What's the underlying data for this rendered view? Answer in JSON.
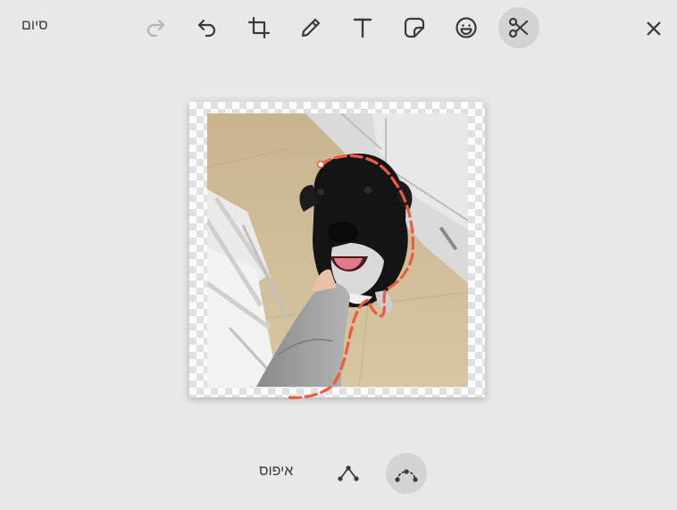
{
  "toolbar": {
    "done_label": "סיום",
    "tools": [
      {
        "name": "redo",
        "icon": "redo-icon",
        "disabled": true
      },
      {
        "name": "undo",
        "icon": "undo-icon"
      },
      {
        "name": "crop",
        "icon": "crop-icon"
      },
      {
        "name": "draw",
        "icon": "pencil-icon"
      },
      {
        "name": "text",
        "icon": "text-icon"
      },
      {
        "name": "sticker",
        "icon": "sticker-icon"
      },
      {
        "name": "emoji",
        "icon": "emoji-icon"
      },
      {
        "name": "cutout",
        "icon": "scissors-icon",
        "active": true
      }
    ],
    "close_icon": "close-icon"
  },
  "editor": {
    "selection_color": "#f05a3c",
    "icon_color": "#3b3b3b",
    "disabled_icon_color": "#b5b5b5"
  },
  "bottom_bar": {
    "reset_label": "איפוס",
    "modes": [
      {
        "name": "polygon-mode",
        "icon": "polygon-icon"
      },
      {
        "name": "curve-mode",
        "icon": "curve-icon",
        "active": true
      }
    ]
  }
}
